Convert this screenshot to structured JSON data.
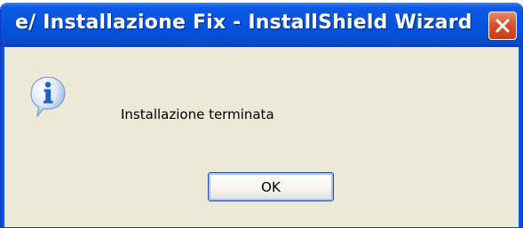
{
  "window": {
    "title": "e/ Installazione Fix - InstallShield Wizard",
    "close_icon": "close-icon"
  },
  "dialog": {
    "icon": "info-icon",
    "message": "Installazione terminata",
    "ok_label": "OK"
  },
  "colors": {
    "titlebar": "#0654df",
    "close_button": "#d8532c",
    "dialog_background": "#ede9d8",
    "icon_blue": "#1f63c8"
  }
}
